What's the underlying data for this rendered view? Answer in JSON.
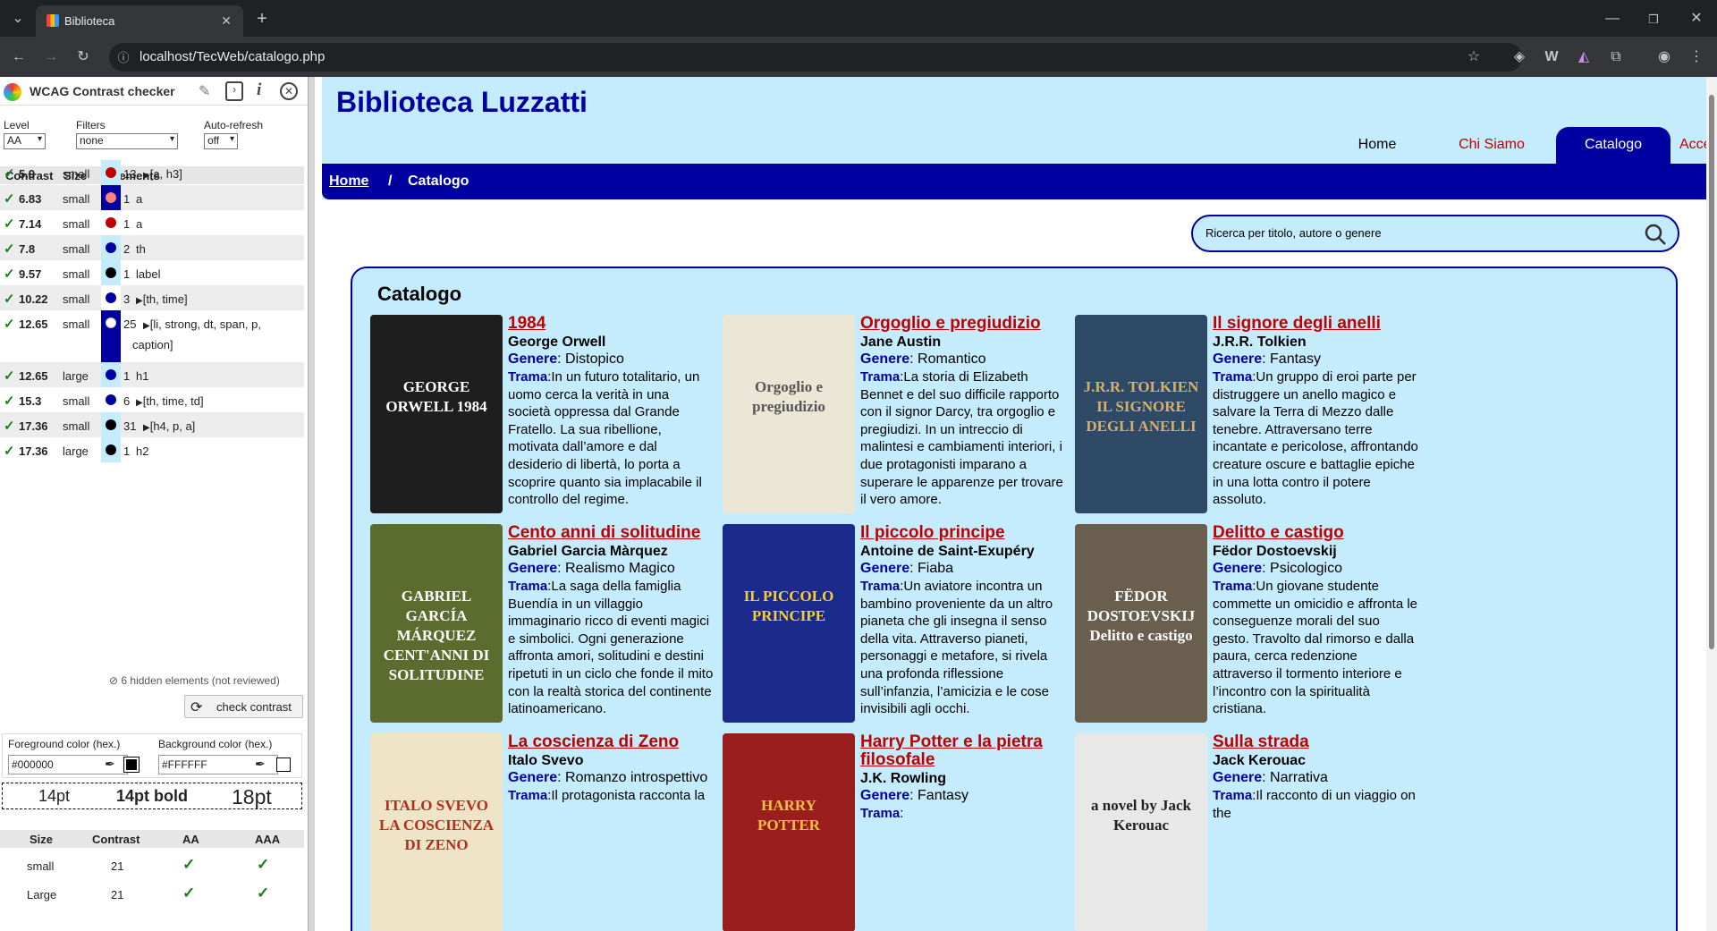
{
  "browser": {
    "tab_title": "Biblioteca",
    "url": "localhost/TecWeb/catalogo.php"
  },
  "checker": {
    "title": "WCAG Contrast checker",
    "level_label": "Level",
    "level_value": "AA",
    "filters_label": "Filters",
    "filters_value": "none",
    "refresh_label": "Auto-refresh",
    "refresh_value": "off",
    "col_contrast": "Contrast",
    "col_size": "Size",
    "col_elements": "Elements",
    "rows": [
      {
        "c": "5.9",
        "s": "small",
        "n": "13",
        "e": "[a, h3]",
        "fg": "#c00000",
        "bg": "#c5ecfd",
        "tri": true
      },
      {
        "c": "6.83",
        "s": "small",
        "n": "1",
        "e": "a",
        "fg": "#ff8080",
        "bg": "#0000a0",
        "tri": false
      },
      {
        "c": "7.14",
        "s": "small",
        "n": "1",
        "e": "a",
        "fg": "#c00000",
        "bg": "#ffffff",
        "tri": false
      },
      {
        "c": "7.8",
        "s": "small",
        "n": "2",
        "e": "th",
        "fg": "#0000a0",
        "bg": "#c5ecfd",
        "tri": false
      },
      {
        "c": "9.57",
        "s": "small",
        "n": "1",
        "e": "label",
        "fg": "#000000",
        "bg": "#c5ecfd",
        "tri": false
      },
      {
        "c": "10.22",
        "s": "small",
        "n": "3",
        "e": "[th, time]",
        "fg": "#0000a0",
        "bg": "#ffffff",
        "tri": true
      },
      {
        "c": "12.65",
        "s": "small",
        "n": "25",
        "e": "[li, strong, dt, span, p,",
        "e2": "caption]",
        "fg": "#ffffff",
        "bg": "#0000a0",
        "tri": true
      },
      {
        "c": "12.65",
        "s": "large",
        "n": "1",
        "e": "h1",
        "fg": "#0000a0",
        "bg": "#c5ecfd",
        "tri": false
      },
      {
        "c": "15.3",
        "s": "small",
        "n": "6",
        "e": "[th, time, td]",
        "fg": "#0000a0",
        "bg": "#ffffff",
        "tri": true
      },
      {
        "c": "17.36",
        "s": "small",
        "n": "31",
        "e": "[h4, p, a]",
        "fg": "#000000",
        "bg": "#c5ecfd",
        "tri": true
      },
      {
        "c": "17.36",
        "s": "large",
        "n": "1",
        "e": "h2",
        "fg": "#000000",
        "bg": "#c5ecfd",
        "tri": false
      }
    ],
    "hidden_note": "6 hidden elements (not reviewed)",
    "check_button": "check contrast",
    "fg_label": "Foreground color (hex.)",
    "fg_value": "#000000",
    "bg_label": "Background color (hex.)",
    "bg_value": "#FFFFFF",
    "sample_14": "14pt",
    "sample_14b": "14pt bold",
    "sample_18": "18pt",
    "res_size": "Size",
    "res_contrast": "Contrast",
    "res_aa": "AA",
    "res_aaa": "AAA",
    "res_rows": [
      {
        "size": "small",
        "contrast": "21"
      },
      {
        "size": "Large",
        "contrast": "21"
      }
    ]
  },
  "site": {
    "title": "Biblioteca Luzzatti",
    "nav": [
      "Home",
      "Chi Siamo",
      "Catalogo",
      "Accedi"
    ],
    "breadcrumb_home": "Home",
    "breadcrumb_sep": "/",
    "breadcrumb_current": "Catalogo",
    "search_placeholder": "Ricerca per titolo, autore o genere",
    "catalog_heading": "Catalogo",
    "genre_label": "Genere",
    "plot_label": "Trama",
    "books": [
      {
        "title": "1984",
        "author": "George Orwell",
        "genre": "Distopico",
        "plot": "In un futuro totalitario, un uomo cerca la verità in una società oppressa dal Grande Fratello. La sua ribellione, motivata dall’amore e dal desiderio di libertà, lo porta a scoprire quanto sia implacabile il controllo del regime.",
        "cover_bg": "#1e1e1e",
        "cover_text": "GEORGE ORWELL 1984",
        "cover_color": "#ffffff"
      },
      {
        "title": "Orgoglio e pregiudizio",
        "author": "Jane Austin",
        "genre": "Romantico",
        "plot": "La storia di Elizabeth Bennet e del suo difficile rapporto con il signor Darcy, tra orgoglio e pregiudizi. In un intreccio di malintesi e cambiamenti interiori, i due protagonisti imparano a superare le apparenze per trovare il vero amore.",
        "cover_bg": "#ece6d6",
        "cover_text": "Orgoglio e pregiudizio",
        "cover_color": "#555555"
      },
      {
        "title": "Il signore degli anelli",
        "author": "J.R.R. Tolkien",
        "genre": "Fantasy",
        "plot": "Un gruppo di eroi parte per distruggere un anello magico e salvare la Terra di Mezzo dalle tenebre. Attraversano terre incantate e pericolose, affrontando creature oscure e battaglie epiche in una lotta contro il potere assoluto.",
        "cover_bg": "#2e4a66",
        "cover_text": "J.R.R. TOLKIEN IL SIGNORE DEGLI ANELLI",
        "cover_color": "#d4b06a"
      },
      {
        "title": "Cento anni di solitudine",
        "author": "Gabriel Garcia Màrquez",
        "genre": "Realismo Magico",
        "plot": "La saga della famiglia Buendía in un villaggio immaginario ricco di eventi magici e simbolici. Ogni generazione affronta amori, solitudini e destini ripetuti in un ciclo che fonde il mito con la realtà storica del continente latinoamericano.",
        "cover_bg": "#5c6b2e",
        "cover_text": "GABRIEL GARCÍA MÁRQUEZ CENT'ANNI DI SOLITUDINE",
        "cover_color": "#ffffff"
      },
      {
        "title": "Il piccolo principe",
        "author": "Antoine de Saint-Exupéry",
        "genre": "Fiaba",
        "plot": "Un aviatore incontra un bambino proveniente da un altro pianeta che gli insegna il senso della vita. Attraverso pianeti, personaggi e metafore, si rivela una profonda riflessione sull’infanzia, l’amicizia e le cose invisibili agli occhi.",
        "cover_bg": "#1c2a8c",
        "cover_text": "IL PICCOLO PRINCIPE",
        "cover_color": "#f5d030"
      },
      {
        "title": "Delitto e castigo",
        "author": "Fëdor Dostoevskij",
        "genre": "Psicologico",
        "plot": "Un giovane studente commette un omicidio e affronta le conseguenze morali del suo gesto. Travolto dal rimorso e dalla paura, cerca redenzione attraverso il tormento interiore e l’incontro con la spiritualità cristiana.",
        "cover_bg": "#6a5e4e",
        "cover_text": "FËDOR DOSTOEVSKIJ Delitto e castigo",
        "cover_color": "#ffffff"
      },
      {
        "title": "La coscienza di Zeno",
        "author": "Italo Svevo",
        "genre": "Romanzo introspettivo",
        "plot": "Il protagonista racconta la",
        "cover_bg": "#efe3c8",
        "cover_text": "ITALO SVEVO LA COSCIENZA DI ZENO",
        "cover_color": "#b03020"
      },
      {
        "title": "Harry Potter e la pietra filosofale",
        "author": "J.K. Rowling",
        "genre": "Fantasy",
        "plot": "",
        "cover_bg": "#9a1e1e",
        "cover_text": "HARRY POTTER",
        "cover_color": "#f0c040"
      },
      {
        "title": "Sulla strada",
        "author": "Jack Kerouac",
        "genre": "Narrativa",
        "plot": "Il racconto di un viaggio on the",
        "cover_bg": "#e8e8e8",
        "cover_text": "a novel by Jack Kerouac",
        "cover_color": "#222222"
      }
    ]
  }
}
